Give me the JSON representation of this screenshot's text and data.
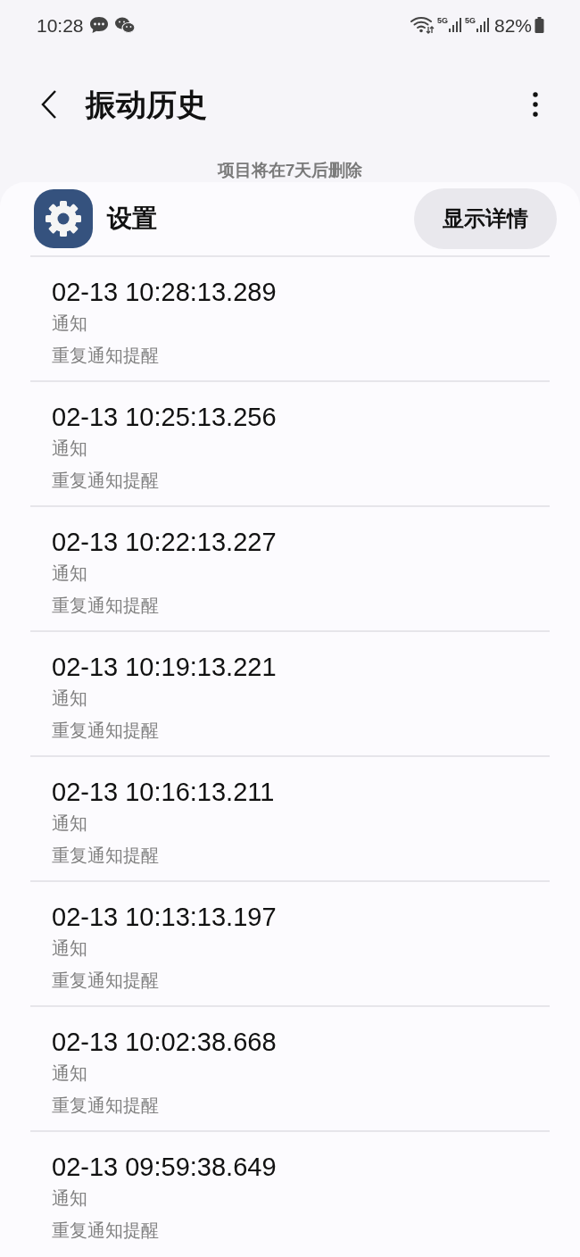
{
  "status_bar": {
    "time": "10:28",
    "network_labels": [
      "5G",
      "5G"
    ],
    "battery": "82%"
  },
  "header": {
    "title": "振动历史"
  },
  "notice": "项目将在7天后删除",
  "app": {
    "name": "设置",
    "button": "显示详情"
  },
  "entries": [
    {
      "time": "02-13 10:28:13.289",
      "category": "通知",
      "pattern": "重复通知提醒"
    },
    {
      "time": "02-13 10:25:13.256",
      "category": "通知",
      "pattern": "重复通知提醒"
    },
    {
      "time": "02-13 10:22:13.227",
      "category": "通知",
      "pattern": "重复通知提醒"
    },
    {
      "time": "02-13 10:19:13.221",
      "category": "通知",
      "pattern": "重复通知提醒"
    },
    {
      "time": "02-13 10:16:13.211",
      "category": "通知",
      "pattern": "重复通知提醒"
    },
    {
      "time": "02-13 10:13:13.197",
      "category": "通知",
      "pattern": "重复通知提醒"
    },
    {
      "time": "02-13 10:02:38.668",
      "category": "通知",
      "pattern": "重复通知提醒"
    },
    {
      "time": "02-13 09:59:38.649",
      "category": "通知",
      "pattern": "重复通知提醒"
    }
  ]
}
